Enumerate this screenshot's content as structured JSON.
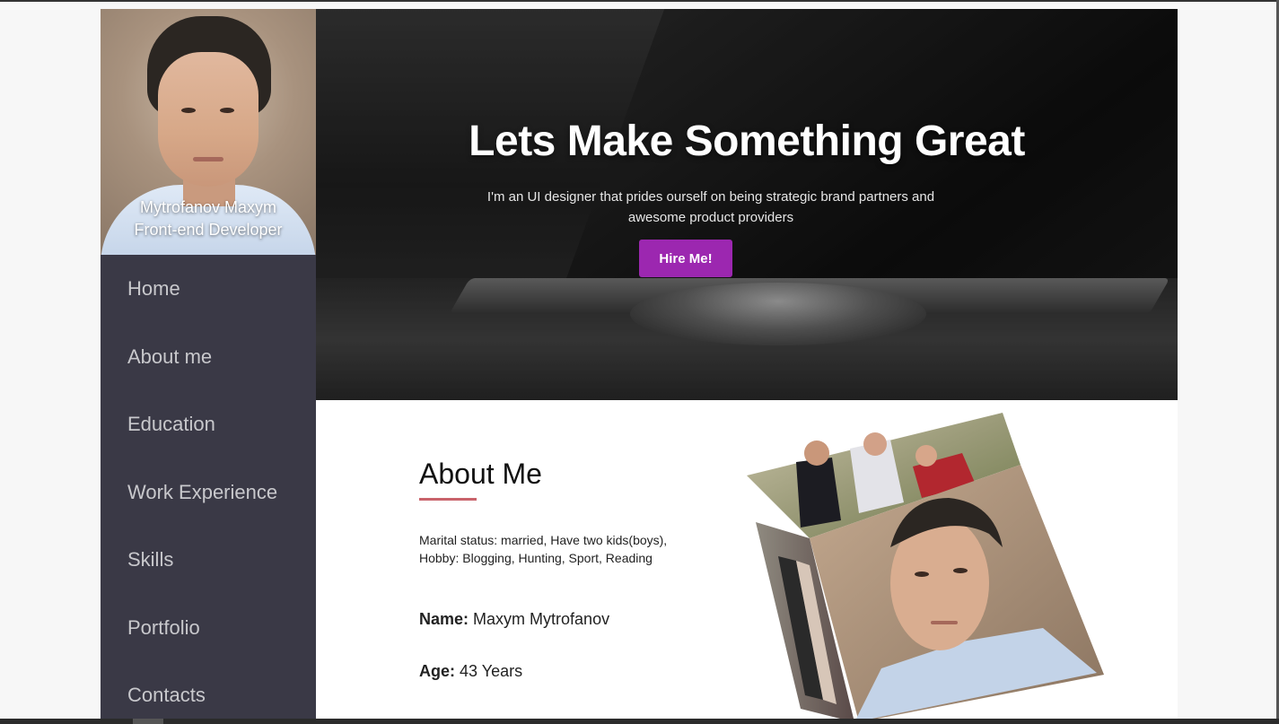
{
  "profile": {
    "name": "Mytrofanov Maxym",
    "role": "Front-end Developer"
  },
  "nav": {
    "items": [
      {
        "label": "Home"
      },
      {
        "label": "About me"
      },
      {
        "label": "Education"
      },
      {
        "label": "Work Experience"
      },
      {
        "label": "Skills"
      },
      {
        "label": "Portfolio"
      },
      {
        "label": "Contacts"
      }
    ]
  },
  "hero": {
    "title": "Lets Make Something Great",
    "intro": "I'm an UI designer that prides ourself on being strategic brand partners and awesome product providers",
    "button_label": "Hire Me!"
  },
  "about": {
    "heading": "About Me",
    "bio_line1": "Marital status: married, Have two kids(boys),",
    "bio_line2": "Hobby: Blogging, Hunting, Sport, Reading",
    "name_label": "Name:",
    "name_value": "Maxym Mytrofanov",
    "age_label": "Age:",
    "age_value": "43 Years"
  },
  "colors": {
    "sidebar_bg": "#3a3946",
    "accent_button": "#9c27b0",
    "heading_underline": "#c9636b"
  }
}
